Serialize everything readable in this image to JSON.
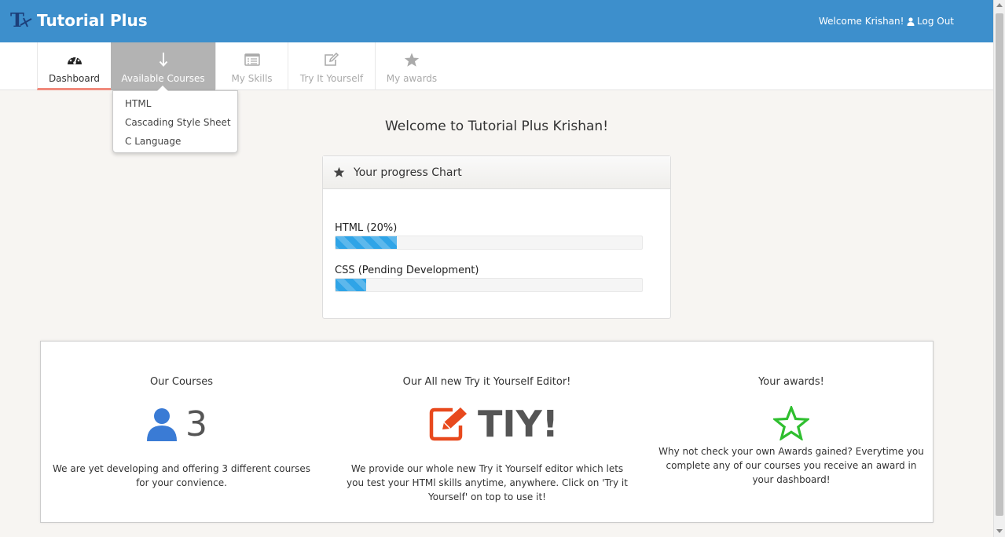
{
  "header": {
    "brand": "Tutorial Plus",
    "welcome": "Welcome Krishan!",
    "logout": "Log Out"
  },
  "nav": {
    "tabs": [
      {
        "label": "Dashboard",
        "icon": "dashboard-icon",
        "state": "active"
      },
      {
        "label": "Available Courses",
        "icon": "arrow-down-icon",
        "state": "open"
      },
      {
        "label": "My Skills",
        "icon": "list-icon",
        "state": "inactive"
      },
      {
        "label": "Try It Yourself",
        "icon": "edit-icon",
        "state": "inactive"
      },
      {
        "label": "My awards",
        "icon": "star-icon",
        "state": "inactive"
      }
    ],
    "dropdown": [
      "HTML",
      "Cascading Style Sheet",
      "C Language"
    ]
  },
  "main": {
    "title": "Welcome to Tutorial Plus Krishan!",
    "progress": {
      "title": "Your progress Chart",
      "bars": [
        {
          "label": "HTML (20%)",
          "value": 0.2
        },
        {
          "label": "CSS (Pending Development)",
          "value": 0.1
        }
      ]
    }
  },
  "features": [
    {
      "title": "Our Courses",
      "big": "3",
      "icon": "user-icon",
      "text": "We are yet developing and offering 3 different courses for your convience."
    },
    {
      "title": "Our All new Try it Yourself Editor!",
      "big": "TIY!",
      "icon": "edit-square-icon",
      "text": "We provide our whole new Try it Yourself editor which lets you test your HTMl skills anytime, anywhere. Click on 'Try it Yourself' on top to use it!"
    },
    {
      "title": "Your awards!",
      "icon": "star-outline-icon",
      "text": "Why not check your own Awards gained? Everytime you complete any of our courses you receive an award in your dashboard!"
    }
  ],
  "colors": {
    "header": "#3d8fcc",
    "progress": "#2fa4e7",
    "active_tab_border": "#f08a7c",
    "courses_icon": "#3a7bd5",
    "tiy_icon": "#e8491d",
    "award_icon": "#2fbf2f"
  }
}
